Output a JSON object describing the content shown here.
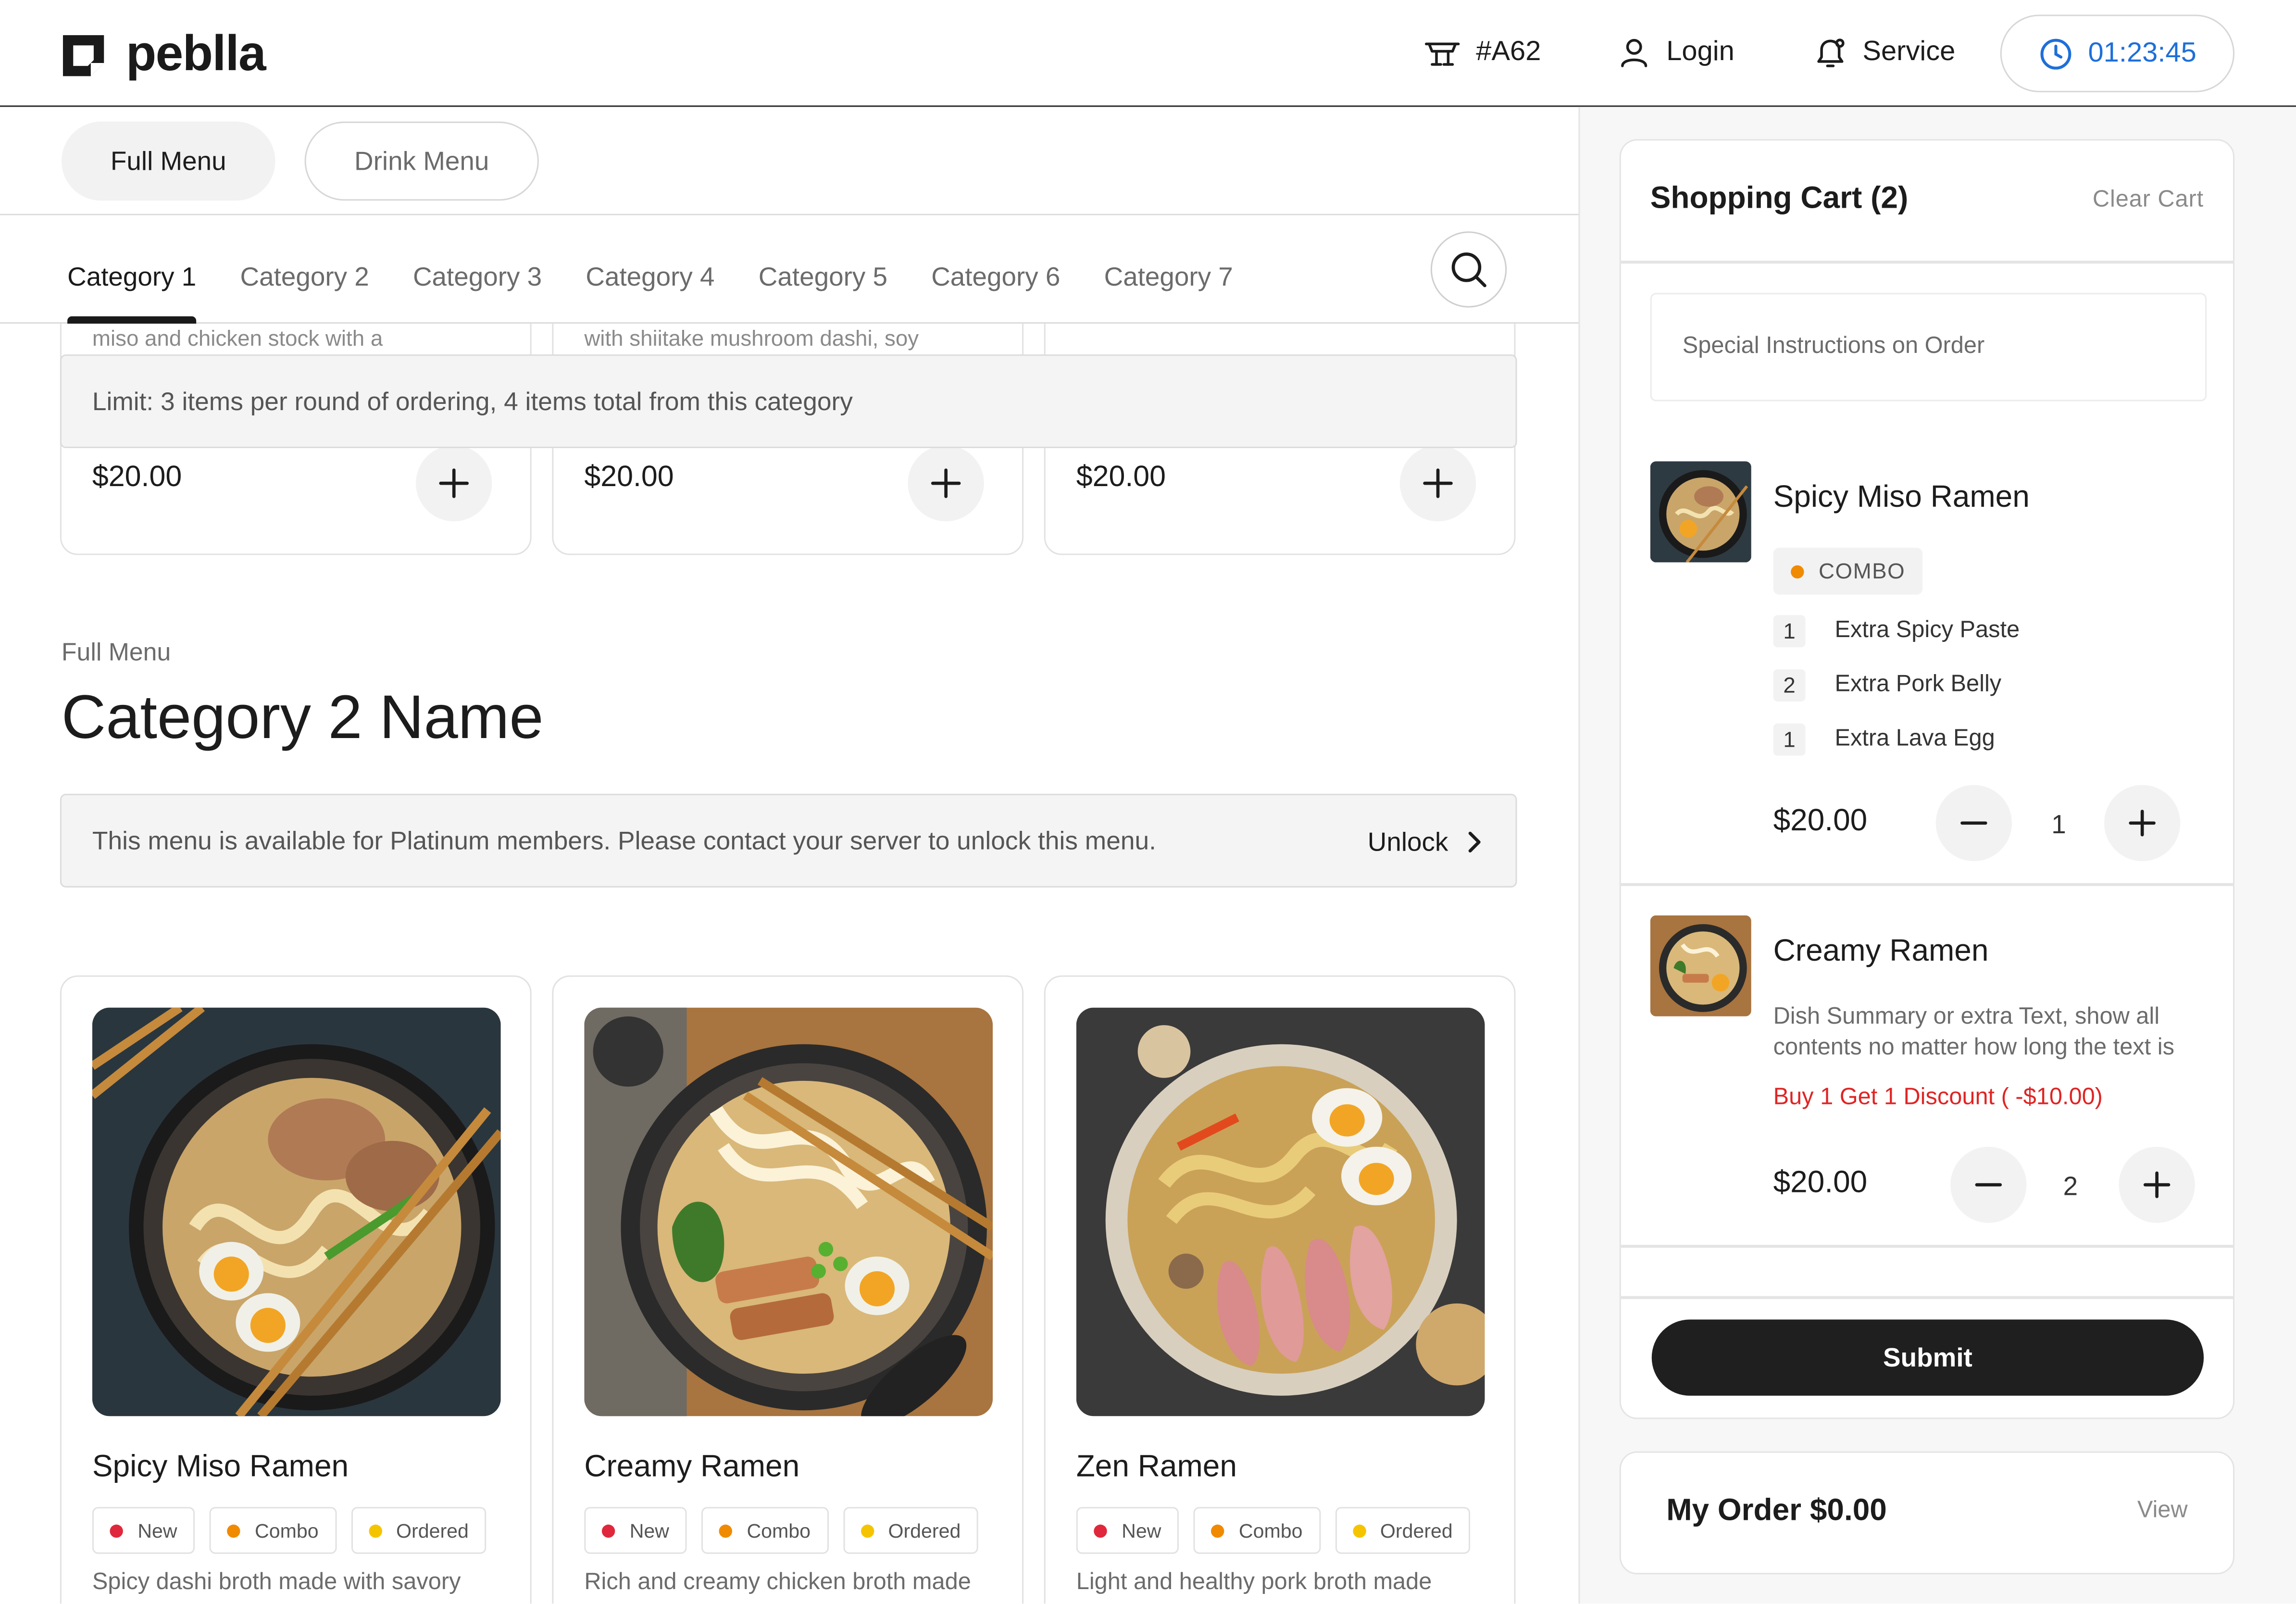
{
  "brand": {
    "name": "peblla"
  },
  "header": {
    "table": "#A62",
    "login": "Login",
    "service": "Service",
    "timer": "01:23:45"
  },
  "menu_tabs": [
    "Full Menu",
    "Drink Menu"
  ],
  "categories": [
    "Category 1",
    "Category 2",
    "Category 3",
    "Category 4",
    "Category 5",
    "Category 6",
    "Category 7"
  ],
  "top_cards": [
    {
      "snippet": "miso and chicken stock with a",
      "price": "$20.00"
    },
    {
      "snippet": "with shiitake mushroom dashi, soy",
      "price": "$20.00"
    },
    {
      "snippet": "",
      "price": "$20.00"
    }
  ],
  "limit_text": "Limit: 3 items per round of ordering, 4 items total from this category",
  "section": {
    "breadcrumb": "Full Menu",
    "title": "Category 2 Name",
    "platinum_text": "This menu is available for Platinum members. Please contact your server to unlock this menu.",
    "unlock_label": "Unlock"
  },
  "tag_labels": {
    "new": "New",
    "combo": "Combo",
    "ordered": "Ordered"
  },
  "colors": {
    "new_dot": "#e0283c",
    "combo_dot": "#f08a00",
    "ordered_dot": "#f5c400",
    "accent": "#1e6fd9",
    "discount": "#e02424"
  },
  "items": [
    {
      "name": "Spicy Miso Ramen",
      "desc": "Spicy dashi broth made with savory"
    },
    {
      "name": "Creamy Ramen",
      "desc": "Rich and creamy chicken broth made"
    },
    {
      "name": "Zen Ramen",
      "desc": "Light and healthy pork broth made"
    }
  ],
  "cart": {
    "title": "Shopping Cart (2)",
    "clear": "Clear Cart",
    "instructions_placeholder": "Special Instructions on Order",
    "items": [
      {
        "name": "Spicy Miso Ramen",
        "badge": "COMBO",
        "addons": [
          {
            "qty": "1",
            "name": "Extra Spicy Paste"
          },
          {
            "qty": "2",
            "name": "Extra Pork Belly"
          },
          {
            "qty": "1",
            "name": "Extra Lava Egg"
          }
        ],
        "price": "$20.00",
        "qty": "1"
      },
      {
        "name": "Creamy Ramen",
        "desc": "Dish Summary or extra Text, show all contents no matter how long the text is",
        "discount": "Buy 1 Get 1 Discount ( -$10.00)",
        "price": "$20.00",
        "qty": "2"
      }
    ],
    "submit": "Submit"
  },
  "order": {
    "title": "My Order $0.00",
    "view": "View"
  }
}
